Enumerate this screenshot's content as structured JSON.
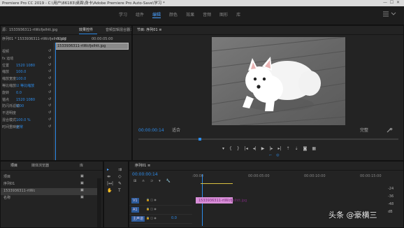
{
  "titlebar": {
    "title": "Premiere Pro CC 2019 - C:\\用户\\86183\\桌面\\身卡\\Adobe Premiere Pro Auto-Save\\学习 *"
  },
  "workspaces": [
    "学习",
    "组件",
    "编辑",
    "颜色",
    "效果",
    "音频",
    "图形",
    "库"
  ],
  "active_workspace_index": 2,
  "effect_controls": {
    "tabs": [
      "源：1533936311-rtWcfjelhtt.jpg",
      "效果控件",
      "音频剪辑混合器：序列01"
    ],
    "clip_label": "序列01 * 1533936311-rtWcfjelhtt.jpg",
    "timecode_left": "00:00",
    "timecode_right": "00:00:05:00",
    "clip_bar_label": "1533936311-rtWcfjelhtt.jpg",
    "rows": [
      {
        "label": "视频",
        "value": ""
      },
      {
        "label": "fx 运动",
        "value": ""
      },
      {
        "label": "位置",
        "value": "1520 1080"
      },
      {
        "label": "缩放",
        "value": "100.0"
      },
      {
        "label": "缩放宽度",
        "value": "100.0"
      },
      {
        "label": "等比缩放",
        "value": "☑ 等比缩放"
      },
      {
        "label": "旋转",
        "value": "0.0"
      },
      {
        "label": "锚点",
        "value": "1520 1080"
      },
      {
        "label": "防闪烁滤镜",
        "value": "0.00"
      },
      {
        "label": "不透明度",
        "value": ""
      },
      {
        "label": "混合模式",
        "value": "100.0 %"
      },
      {
        "label": "时间重映射",
        "value": "正常"
      }
    ]
  },
  "program_monitor": {
    "title": "节目: 序列01 ≡",
    "timecode": "00:00:00:14",
    "fit": "适合",
    "quality": "完整",
    "image_alt": "白色萨摩耶幼犬趴在木地板上"
  },
  "project_panel": {
    "tabs": [
      "项目",
      "媒体浏览器",
      "库"
    ],
    "items": [
      "项目",
      "序列01",
      "1533936311-rtWc",
      "名称"
    ]
  },
  "timeline": {
    "tab": "序列01 ≡",
    "timecode": "00:00:00:14",
    "ruler_labels": [
      ":00:00",
      "00:00:05:00",
      "00:00:10:00",
      "00:00:15:00"
    ],
    "tracks": [
      {
        "name": "V1",
        "label": "V1"
      },
      {
        "name": "A1",
        "label": "A1"
      },
      {
        "name": "主声道",
        "label": "主声道",
        "value": "0.0"
      }
    ],
    "clip_label": "1533936311-rtWcfjelhtt.jpg",
    "meter_values": [
      "-24",
      "-36",
      "-48",
      "dB"
    ]
  },
  "watermark": {
    "text": "头条 @豪横三"
  },
  "colors": {
    "accent": "#2d8ceb",
    "clip": "#d88ed8",
    "playhead": "#2d8ceb"
  }
}
